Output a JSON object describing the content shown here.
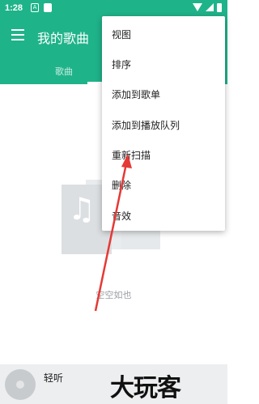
{
  "status": {
    "time": "1:28",
    "notif1": "A"
  },
  "appbar": {
    "title": "我的歌曲"
  },
  "tabs": [
    {
      "label": "歌曲"
    }
  ],
  "menu": {
    "items": [
      {
        "label": "视图"
      },
      {
        "label": "排序"
      },
      {
        "label": "添加到歌单"
      },
      {
        "label": "添加到播放队列"
      },
      {
        "label": "重新扫描"
      },
      {
        "label": "删除"
      },
      {
        "label": "音效"
      }
    ]
  },
  "empty": {
    "message": "空空如也"
  },
  "player": {
    "track": "轻听"
  },
  "watermark": {
    "text": "大玩客"
  },
  "colors": {
    "primary": "#1fb38a",
    "arrow": "#e53935"
  },
  "icons": {
    "menu": "hamburger-icon",
    "empty": "music-note-icon",
    "album": "album-art-icon"
  }
}
